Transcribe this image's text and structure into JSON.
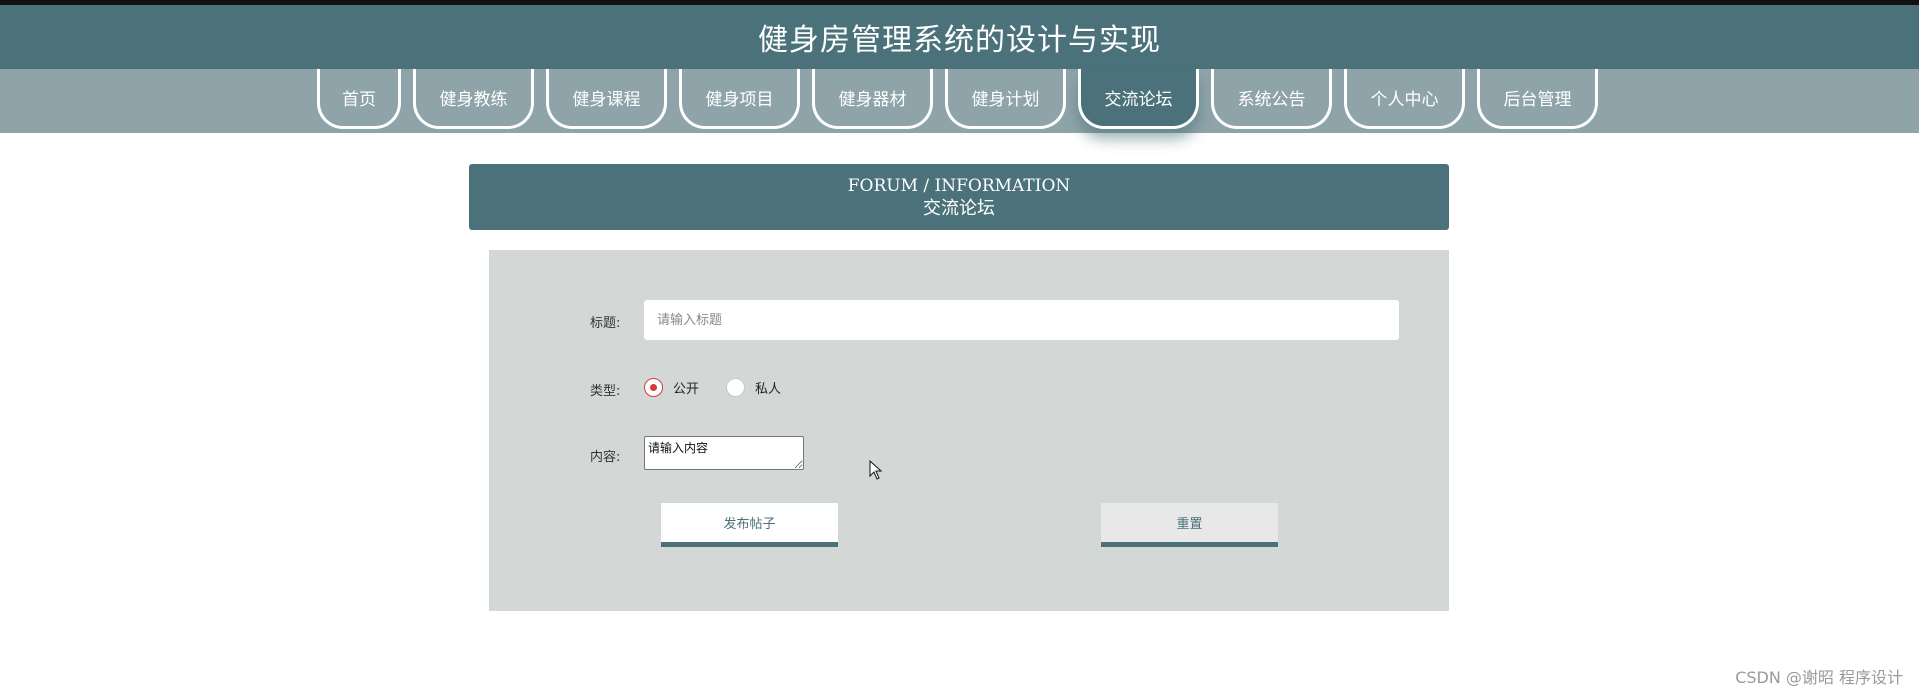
{
  "header": {
    "title": "健身房管理系统的设计与实现"
  },
  "nav": {
    "items": [
      {
        "label": "首页",
        "width": 84
      },
      {
        "label": "健身教练",
        "width": 121
      },
      {
        "label": "健身课程",
        "width": 121
      },
      {
        "label": "健身项目",
        "width": 121
      },
      {
        "label": "健身器材",
        "width": 121
      },
      {
        "label": "健身计划",
        "width": 121
      },
      {
        "label": "交流论坛",
        "width": 121
      },
      {
        "label": "系统公告",
        "width": 121
      },
      {
        "label": "个人中心",
        "width": 121
      },
      {
        "label": "后台管理",
        "width": 121
      }
    ],
    "active": "交流论坛"
  },
  "panel": {
    "title_en": "FORUM / INFORMATION",
    "title_cn": "交流论坛"
  },
  "form": {
    "title_label": "标题:",
    "title_placeholder": "请输入标题",
    "type_label": "类型:",
    "type_options": [
      "公开",
      "私人"
    ],
    "type_selected": "公开",
    "content_label": "内容:",
    "content_placeholder": "请输入内容",
    "submit_label": "发布帖子",
    "reset_label": "重置"
  },
  "watermark": "CSDN @谢昭  程序设计",
  "colors": {
    "primary": "#4b727a",
    "nav_bg": "#8ea4a9",
    "form_bg": "#d3d8d7",
    "radio_checked": "#d33a3a"
  }
}
